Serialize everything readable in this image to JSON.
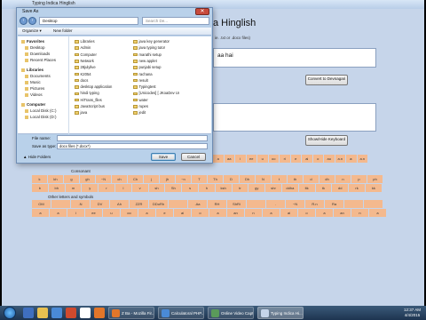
{
  "app": {
    "window_title": "Typing Indica Hinglish",
    "heading": "a Hinglish",
    "hint": "ie. .txt or .docx files)",
    "top_text": "aa hai",
    "convert_button": "Convert to Devnagari",
    "showhide_button": "Show/Hide Keyboard",
    "consonant_label": "Consonant",
    "other_label": "Other letters and symbols",
    "vowel_keys": [
      "a",
      "aa",
      "i",
      "ee",
      "u",
      "oo",
      "ri",
      "e",
      "ai",
      "o",
      "au",
      "a.n",
      "a:",
      "a.n"
    ],
    "consonant_keys": [
      "k",
      "kh",
      "g",
      "gh",
      "~N",
      "ch",
      "Ch",
      "j",
      "jh",
      "~n",
      "T",
      "Th",
      "D",
      "Dh",
      "N",
      "t",
      "th",
      "d",
      "dh",
      "n",
      "p",
      "ph",
      "b",
      "bh",
      "m",
      "y",
      "r",
      "l",
      "v",
      "sh",
      "Sh",
      "s",
      "h",
      "ksh",
      "tr",
      "gy",
      "shr",
      "ddha",
      "ltk",
      "tk",
      "dd",
      "rk",
      "kk"
    ],
    "other_keys_1": [
      "OM",
      "",
      ".N",
      "DV",
      "Ah",
      "ZZR",
      "DDoRh",
      "",
      ".Aa",
      "RH",
      "ShRi",
      "",
      ".",
      "~N",
      "R.n",
      "Ra",
      "",
      ""
    ],
    "other_keys_2": [
      "a",
      "a",
      "i",
      "ee",
      "u",
      "oo",
      "a",
      "e",
      "ai",
      "o",
      "a",
      "an",
      "n",
      "a",
      "ai",
      "o",
      "a",
      "an",
      "n",
      "a"
    ]
  },
  "dialog": {
    "title": "Save As",
    "path": "Desktop",
    "search_placeholder": "Search De...",
    "organize": "Organize ▾",
    "new_folder": "New folder",
    "nav_items": [
      {
        "label": "Favorites",
        "group": true
      },
      {
        "label": "Desktop",
        "group": false
      },
      {
        "label": "Downloads",
        "group": false
      },
      {
        "label": "Recent Places",
        "group": false
      },
      {
        "label": "Libraries",
        "group": true
      },
      {
        "label": "Documents",
        "group": false
      },
      {
        "label": "Music",
        "group": false
      },
      {
        "label": "Pictures",
        "group": false
      },
      {
        "label": "Videos",
        "group": false
      },
      {
        "label": "Computer",
        "group": true
      },
      {
        "label": "Local Disk (C:)",
        "group": false
      },
      {
        "label": "Local Disk (D:)",
        "group": false
      }
    ],
    "files_col1": [
      "Libraries",
      "Admin",
      "Computer",
      "Network",
      "28julylive",
      "K2054",
      "docs",
      "desktop application",
      "hindi typing",
      "HiTrans_files",
      "JavaScript bus",
      "java"
    ],
    "files_col2": [
      "java key generator",
      "java typing tutor",
      "marathi setup",
      "new applet",
      "punjabi setup",
      "rachana",
      "result",
      "Typingtest",
      "[Unicodes] [ JKoaDev Unicode Converter Download #5]",
      "water",
      "rupes",
      "jedit"
    ],
    "file_name_label": "File name:",
    "file_name_value": "",
    "save_type_label": "Save as type:",
    "save_type_value": "docx files (*.docx*)",
    "hide_folders": "Hide Folders",
    "save_button": "Save",
    "cancel_button": "Cancel"
  },
  "taskbar": {
    "tasks": [
      "Z Ba - Mozilla Fir...",
      "Calculatoral PHP...",
      "Online Video Capt...",
      "Typing Indica Hi..."
    ],
    "time": "12:37 AM",
    "date": "4/4/2015"
  },
  "colors": {
    "app_bg": "#c6d5ea",
    "key_bg": "#f4b98e",
    "dialog_bg": "#b9d1ea",
    "taskbar_bg": "#2a4564"
  }
}
